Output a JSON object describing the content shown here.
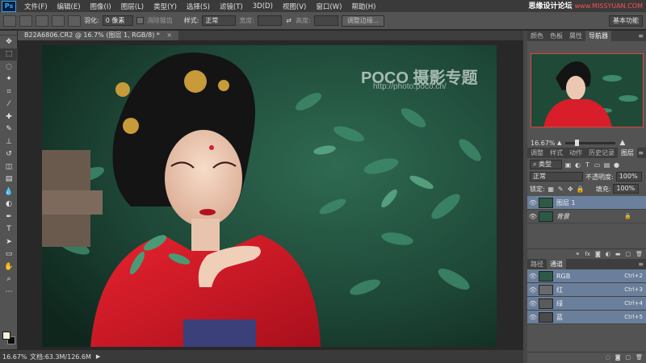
{
  "menubar": {
    "logo": "Ps",
    "items": [
      "文件(F)",
      "编辑(E)",
      "图像(I)",
      "图层(L)",
      "类型(Y)",
      "选择(S)",
      "滤镜(T)",
      "3D(D)",
      "视图(V)",
      "窗口(W)",
      "帮助(H)"
    ],
    "watermark": "思缘设计论坛",
    "watermark_url": "www.MISSYUAN.COM"
  },
  "options": {
    "feather_label": "羽化:",
    "feather_value": "0 像素",
    "antialias_label": "消除锯齿",
    "style_label": "样式:",
    "style_value": "正常",
    "width_label": "宽度:",
    "height_label": "高度:",
    "refine_edge_label": "调整边缘...",
    "workspace": "基本功能"
  },
  "document": {
    "tab_title": "B22A6806.CR2 @ 16.7% (图层 1, RGB/8) *",
    "close": "×"
  },
  "photo": {
    "brand": "POCO 摄影专题",
    "url": "http://photo.poco.cn/"
  },
  "status": {
    "zoom": "16.67%",
    "doc_size": "文档:63.3M/126.6M",
    "arrow": "▶"
  },
  "navigator": {
    "tabs": [
      "颜色",
      "色板",
      "属性",
      "导航器"
    ],
    "active_tab": "导航器",
    "zoom": "16.67%"
  },
  "layers_panel": {
    "tabs": [
      "调整",
      "样式",
      "动作",
      "历史记录",
      "图层"
    ],
    "active_tab": "图层",
    "kind_label": "类型",
    "blend_mode": "正常",
    "opacity_label": "不透明度:",
    "opacity_value": "100%",
    "lock_label": "锁定:",
    "fill_label": "填充:",
    "fill_value": "100%",
    "layers": [
      {
        "name": "图层 1",
        "selected": true
      },
      {
        "name": "背景",
        "selected": false,
        "locked": true
      }
    ]
  },
  "channels_panel": {
    "tabs": [
      "路径",
      "通道"
    ],
    "active_tab": "通道",
    "channels": [
      {
        "name": "RGB",
        "shortcut": "Ctrl+2"
      },
      {
        "name": "红",
        "shortcut": "Ctrl+3"
      },
      {
        "name": "绿",
        "shortcut": "Ctrl+4"
      },
      {
        "name": "蓝",
        "shortcut": "Ctrl+5"
      }
    ]
  },
  "colors": {
    "foreground": "#f5efdb",
    "background": "#0b0b0b",
    "selection": "#6a7f9b",
    "accent": "#e5453b"
  },
  "tools": [
    "move-tool",
    "marquee-tool",
    "lasso-tool",
    "quick-select-tool",
    "crop-tool",
    "eyedropper-tool",
    "healing-brush-tool",
    "brush-tool",
    "clone-stamp-tool",
    "history-brush-tool",
    "eraser-tool",
    "gradient-tool",
    "blur-tool",
    "dodge-tool",
    "pen-tool",
    "type-tool",
    "path-select-tool",
    "shape-tool",
    "hand-tool",
    "zoom-tool"
  ]
}
